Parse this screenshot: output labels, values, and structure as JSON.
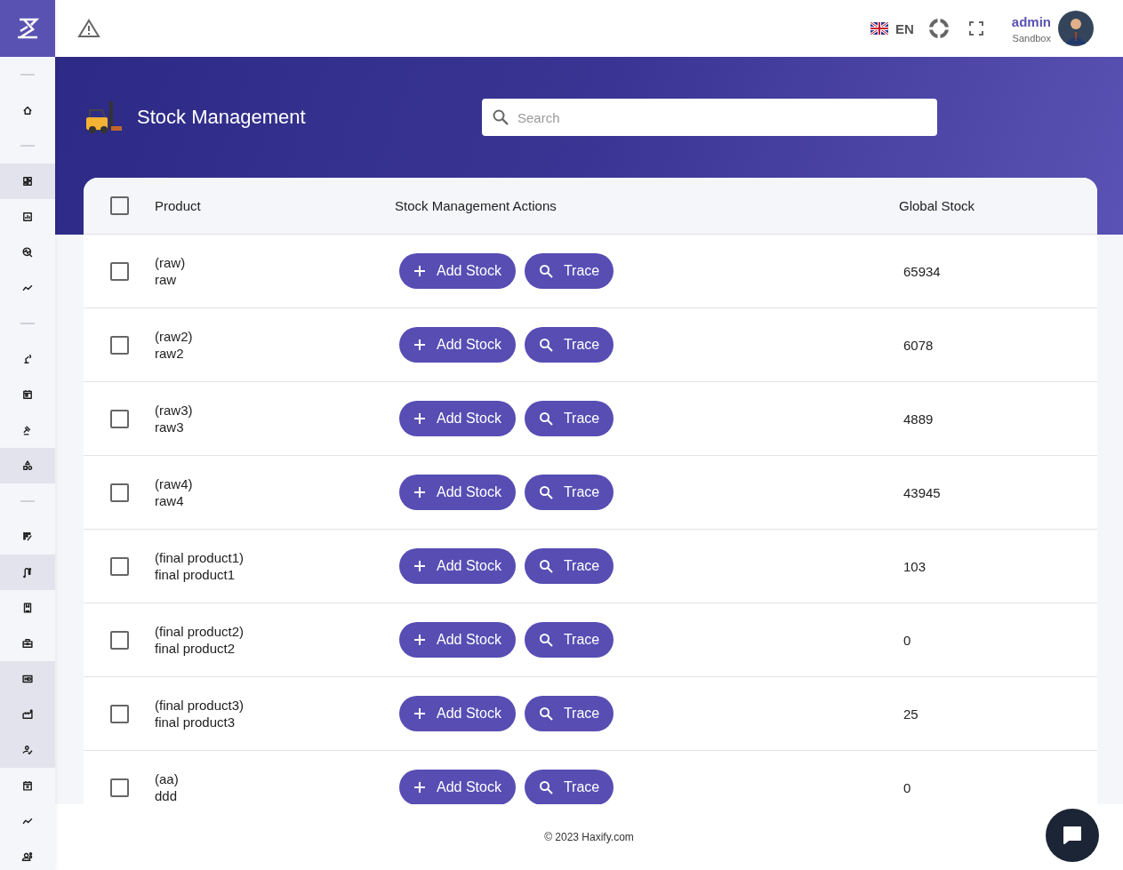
{
  "header": {
    "language": "EN",
    "user": {
      "name": "admin",
      "role": "Sandbox"
    }
  },
  "sidebar": {
    "items": [
      {
        "kind": "divider"
      },
      {
        "kind": "home",
        "highlighted": false
      },
      {
        "kind": "divider"
      },
      {
        "kind": "dashboard",
        "highlighted": true
      },
      {
        "kind": "bar-chart",
        "highlighted": false
      },
      {
        "kind": "analytics-search",
        "highlighted": false
      },
      {
        "kind": "trend",
        "highlighted": false
      },
      {
        "kind": "divider"
      },
      {
        "kind": "robot-arm",
        "highlighted": false
      },
      {
        "kind": "calendar",
        "highlighted": false
      },
      {
        "kind": "gavel",
        "highlighted": false
      },
      {
        "kind": "shapes",
        "highlighted": true
      },
      {
        "kind": "divider"
      },
      {
        "kind": "grid-edit",
        "highlighted": false
      },
      {
        "kind": "route",
        "highlighted": true
      },
      {
        "kind": "book",
        "highlighted": false
      },
      {
        "kind": "briefcase",
        "highlighted": false
      },
      {
        "kind": "hd",
        "highlighted": true
      },
      {
        "kind": "factory",
        "highlighted": true
      },
      {
        "kind": "person-check",
        "highlighted": true
      },
      {
        "kind": "calendar-x",
        "highlighted": false
      },
      {
        "kind": "trend",
        "highlighted": false
      },
      {
        "kind": "engineer",
        "highlighted": false
      }
    ]
  },
  "page": {
    "title": "Stock Management",
    "search": {
      "placeholder": "Search"
    }
  },
  "table": {
    "columns": [
      "Product",
      "Stock Management Actions",
      "Global Stock"
    ],
    "select_all_checked": false,
    "rows": [
      {
        "code": "(raw)",
        "name": "raw",
        "checked": false,
        "actions": [
          "Add Stock",
          "Trace"
        ],
        "global_stock": "65934"
      },
      {
        "code": "(raw2)",
        "name": "raw2",
        "checked": false,
        "actions": [
          "Add Stock",
          "Trace"
        ],
        "global_stock": "6078"
      },
      {
        "code": "(raw3)",
        "name": "raw3",
        "checked": false,
        "actions": [
          "Add Stock",
          "Trace"
        ],
        "global_stock": "4889"
      },
      {
        "code": "(raw4)",
        "name": "raw4",
        "checked": false,
        "actions": [
          "Add Stock",
          "Trace"
        ],
        "global_stock": "43945"
      },
      {
        "code": "(final product1)",
        "name": "final product1",
        "checked": false,
        "actions": [
          "Add Stock",
          "Trace"
        ],
        "global_stock": "103"
      },
      {
        "code": "(final product2)",
        "name": "final product2",
        "checked": false,
        "actions": [
          "Add Stock",
          "Trace"
        ],
        "global_stock": "0"
      },
      {
        "code": "(final product3)",
        "name": "final product3",
        "checked": false,
        "actions": [
          "Add Stock",
          "Trace"
        ],
        "global_stock": "25"
      },
      {
        "code": "(aa)",
        "name": "ddd",
        "checked": false,
        "actions": [
          "Add Stock",
          "Trace"
        ],
        "global_stock": "0"
      }
    ]
  },
  "footer": {
    "text": "© 2023 Haxify.com"
  }
}
